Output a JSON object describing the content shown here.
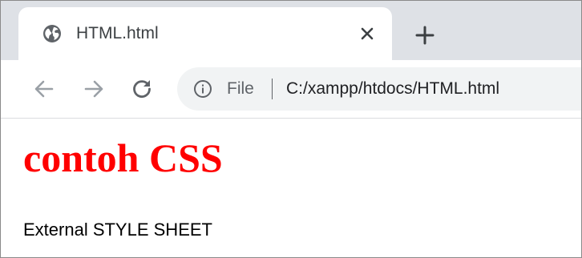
{
  "browser": {
    "tab": {
      "title": "HTML.html",
      "favicon": "globe-icon"
    },
    "toolbar": {
      "back_icon": "arrow-left-icon",
      "forward_icon": "arrow-right-icon",
      "reload_icon": "reload-icon"
    },
    "omnibox": {
      "info_icon": "info-icon",
      "scheme_label": "File",
      "url": "C:/xampp/htdocs/HTML.html"
    }
  },
  "page": {
    "heading": "contoh CSS",
    "heading_color": "#ff0000",
    "paragraph": "External STYLE SHEET"
  },
  "colors": {
    "tab_strip": "#dee1e6",
    "omnibox_bg": "#f1f3f4",
    "icon_gray": "#5f6368"
  }
}
